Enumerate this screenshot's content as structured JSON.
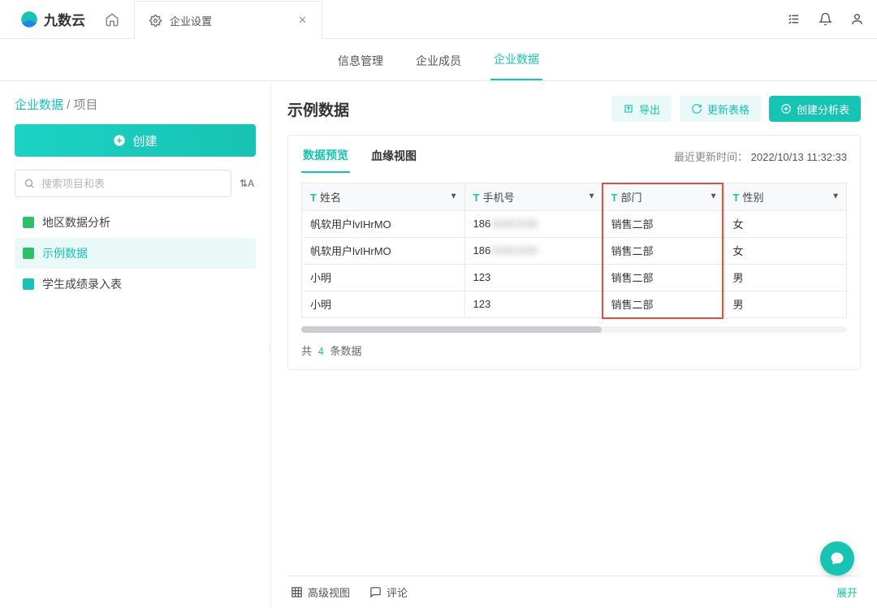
{
  "brand": "九数云",
  "top_tab": {
    "label": "企业设置"
  },
  "sub_nav": {
    "info": "信息管理",
    "members": "企业成员",
    "data": "企业数据"
  },
  "breadcrumb": {
    "root": "企业数据",
    "sep": " / ",
    "leaf": "项目"
  },
  "sidebar": {
    "create_label": "创建",
    "search_placeholder": "搜索项目和表",
    "items": [
      {
        "label": "地区数据分析"
      },
      {
        "label": "示例数据"
      },
      {
        "label": "学生成绩录入表"
      }
    ]
  },
  "content": {
    "title": "示例数据",
    "export_label": "导出",
    "refresh_label": "更新表格",
    "create_report_label": "创建分析表"
  },
  "panel": {
    "tabs": {
      "preview": "数据预览",
      "lineage": "血缘视图"
    },
    "update_label": "最近更新时间：",
    "update_time": "2022/10/13 11:32:33"
  },
  "columns": [
    {
      "type": "T",
      "label": "姓名"
    },
    {
      "type": "T",
      "label": "手机号"
    },
    {
      "type": "T",
      "label": "部门"
    },
    {
      "type": "T",
      "label": "性别"
    }
  ],
  "rows": [
    {
      "name": "帆软用户lvIHrMO",
      "phone_prefix": "186",
      "phone_blur": "33461536",
      "dept": "销售二部",
      "gender": "女"
    },
    {
      "name": "帆软用户lvIHrMO",
      "phone_prefix": "186",
      "phone_blur": "03461500",
      "dept": "销售二部",
      "gender": "女"
    },
    {
      "name": "小明",
      "phone_prefix": "123",
      "phone_blur": "",
      "dept": "销售二部",
      "gender": "男"
    },
    {
      "name": "小明",
      "phone_prefix": "123",
      "phone_blur": "",
      "dept": "销售二部",
      "gender": "男"
    }
  ],
  "summary": {
    "prefix": "共",
    "count": "4",
    "suffix": "条数据"
  },
  "footer": {
    "advanced": "高级视图",
    "comment": "评论",
    "expand": "展开"
  }
}
